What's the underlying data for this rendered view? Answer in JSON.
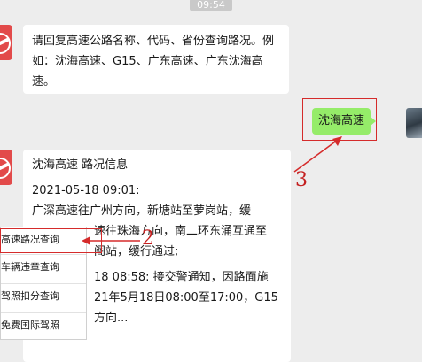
{
  "status_time": "09:54",
  "messages": {
    "bot_intro": "请回复高速公路名称、代码、省份查询路况。例如：沈海高速、G15、广东高速、广东沈海高速。",
    "user_query": "沈海高速",
    "bot_reply_lines": [
      "沈海高速 路况信息",
      "",
      "2021-05-18 09:01:",
      "广深高速往广州方向，新塘站至萝岗站，缓",
      "",
      "速往珠海方向，南二环东涌互通至",
      "阁站，缓行通过;",
      "",
      "18 08:58: 接交警通知，因路面施",
      "21年5月18日08:00至17:00，G15",
      "方向..."
    ]
  },
  "menu": {
    "items": [
      "高速路况查询",
      "车辆违章查询",
      "驾照扣分查询",
      "免费国际驾照"
    ]
  },
  "annotations": {
    "label_2": "2",
    "label_3": "3"
  },
  "colors": {
    "annotation_red": "#d52b2b",
    "user_bubble_green": "#95ec69",
    "bot_avatar_red": "#e24a4a"
  }
}
